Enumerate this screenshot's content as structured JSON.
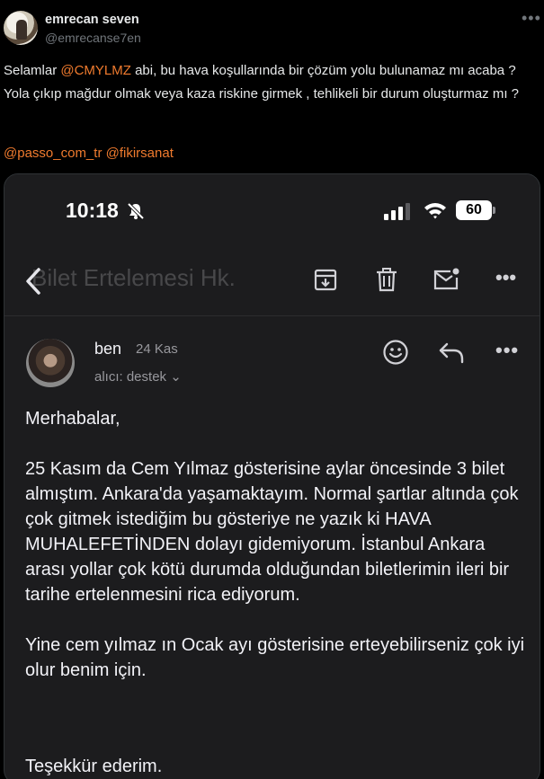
{
  "author": {
    "name": "emrecan seven",
    "handle": "@emrecanse7en"
  },
  "more_label": "•••",
  "tweet": {
    "part1": "Selamlar ",
    "mention1": "@CMYLMZ",
    "part2": " abi, bu hava koşullarında bir çözüm yolu bulunamaz mı acaba ? Yola çıkıp mağdur olmak veya kaza riskine girmek , tehlikeli bir durum oluşturmaz mı ?",
    "mention2": "@passo_com_tr",
    "space": " ",
    "mention3": "@fikirsanat"
  },
  "phone": {
    "time": "10:18",
    "battery": "60"
  },
  "mail": {
    "subject": "Bilet Ertelemesi Hk.",
    "sender": "ben",
    "date": "24 Kas",
    "recipient": "alıcı: destek ⌄",
    "more": "•••",
    "paragraphs": [
      "Merhabalar,",
      "25 Kasım da Cem Yılmaz gösterisine aylar öncesinde 3 bilet almıştım. Ankara'da yaşamaktayım. Normal şartlar altında çok çok gitmek istediğim bu gösteriye ne yazık ki HAVA MUHALEFETİNDEN dolayı gidemiyorum. İstanbul Ankara arası yollar çok kötü durumda olduğundan biletlerimin ileri bir tarihe ertelenmesini rica ediyorum.",
      "Yine cem yılmaz ın Ocak ayı gösterisine erteyebilirseniz çok iyi olur benim için."
    ],
    "closing": "Teşekkür ederim."
  },
  "colors": {
    "mention": "#f07b2e",
    "background": "#000000",
    "mail_bg": "#1c1c1e"
  }
}
